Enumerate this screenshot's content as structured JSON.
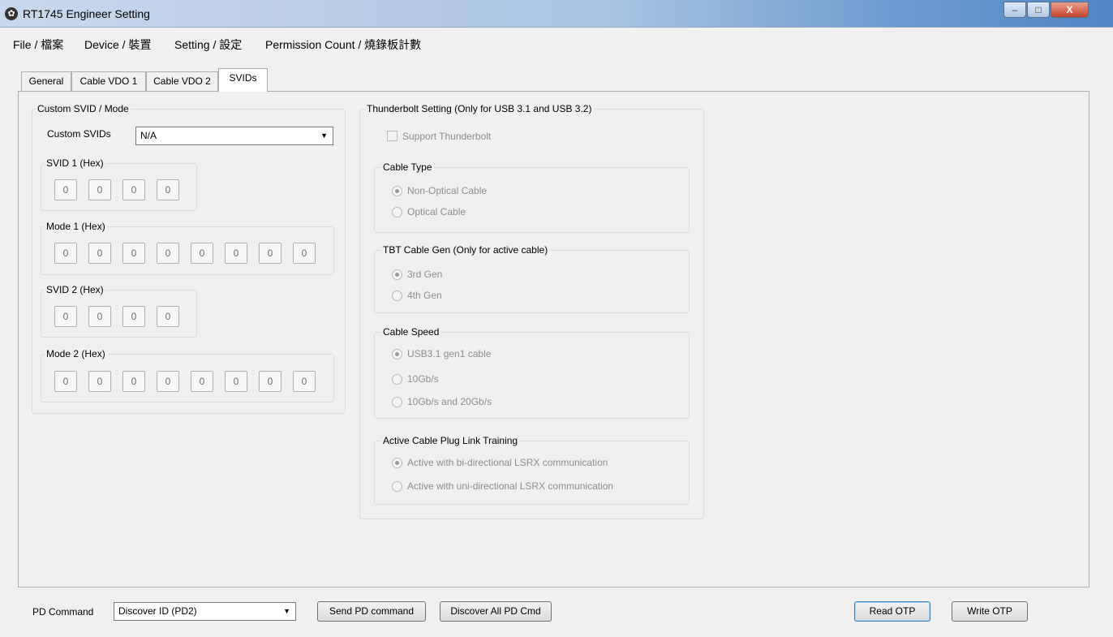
{
  "window": {
    "title": "RT1745 Engineer Setting",
    "icon": "gear-icon",
    "minimize": "–",
    "maximize": "□",
    "close": "X"
  },
  "menu": [
    "File / 檔案",
    "Device / 裝置",
    "Setting / 設定",
    "Permission Count / 燒錄板計數"
  ],
  "tabs": [
    "General",
    "Cable VDO 1",
    "Cable VDO 2",
    "SVIDs"
  ],
  "active_tab": "SVIDs",
  "custom": {
    "group_title": "Custom SVID / Mode",
    "svids_label": "Custom SVIDs",
    "svids_value": "N/A",
    "svid1_title": "SVID 1 (Hex)",
    "svid1": [
      "0",
      "0",
      "0",
      "0"
    ],
    "mode1_title": "Mode 1 (Hex)",
    "mode1": [
      "0",
      "0",
      "0",
      "0",
      "0",
      "0",
      "0",
      "0"
    ],
    "svid2_title": "SVID 2 (Hex)",
    "svid2": [
      "0",
      "0",
      "0",
      "0"
    ],
    "mode2_title": "Mode 2 (Hex)",
    "mode2": [
      "0",
      "0",
      "0",
      "0",
      "0",
      "0",
      "0",
      "0"
    ]
  },
  "thunderbolt": {
    "group_title": "Thunderbolt Setting (Only for USB 3.1 and USB 3.2)",
    "support_label": "Support Thunderbolt",
    "support_checked": false,
    "cable_type": {
      "title": "Cable Type",
      "options": [
        "Non-Optical Cable",
        "Optical Cable"
      ],
      "selected": 0
    },
    "tbt_gen": {
      "title": "TBT Cable Gen (Only for active cable)",
      "options": [
        "3rd Gen",
        "4th Gen"
      ],
      "selected": 0
    },
    "cable_speed": {
      "title": "Cable Speed",
      "options": [
        "USB3.1 gen1 cable",
        "10Gb/s",
        "10Gb/s and 20Gb/s"
      ],
      "selected": 0
    },
    "link_training": {
      "title": "Active Cable Plug Link Training",
      "options": [
        "Active with bi-directional LSRX communication",
        "Active with uni-directional LSRX communication"
      ],
      "selected": 0
    }
  },
  "bottom": {
    "pd_label": "PD Command",
    "pd_value": "Discover ID (PD2)",
    "send_button": "Send PD command",
    "discover_all_button": "Discover All PD Cmd",
    "read_otp_button": "Read OTP",
    "write_otp_button": "Write OTP"
  }
}
